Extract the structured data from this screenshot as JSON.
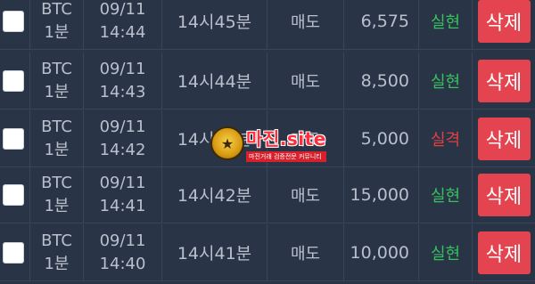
{
  "colors": {
    "background": "#2a3447",
    "win": "#35c25c",
    "lose": "#e0403f",
    "delete_button": "#e3444f"
  },
  "rows": [
    {
      "symbol": "BTC",
      "interval": "1분",
      "date": "09/11",
      "time": "14:44",
      "round": "14시45분",
      "side": "매도",
      "amount": "6,575",
      "result": "실현",
      "result_type": "win",
      "delete_label": "삭제"
    },
    {
      "symbol": "BTC",
      "interval": "1분",
      "date": "09/11",
      "time": "14:43",
      "round": "14시44분",
      "side": "매도",
      "amount": "8,500",
      "result": "실현",
      "result_type": "win",
      "delete_label": "삭제"
    },
    {
      "symbol": "BTC",
      "interval": "1분",
      "date": "09/11",
      "time": "14:42",
      "round": "14시43분",
      "side": "매도",
      "amount": "5,000",
      "result": "실격",
      "result_type": "lose",
      "delete_label": "삭제"
    },
    {
      "symbol": "BTC",
      "interval": "1분",
      "date": "09/11",
      "time": "14:41",
      "round": "14시42분",
      "side": "매도",
      "amount": "15,000",
      "result": "실현",
      "result_type": "win",
      "delete_label": "삭제"
    },
    {
      "symbol": "BTC",
      "interval": "1분",
      "date": "09/11",
      "time": "14:40",
      "round": "14시41분",
      "side": "매도",
      "amount": "10,000",
      "result": "실현",
      "result_type": "win",
      "delete_label": "삭제"
    }
  ],
  "watermark": {
    "title": "마진.site",
    "subtitle": "마진거래 검증전문 커뮤니티",
    "icon": "emblem-icon"
  }
}
